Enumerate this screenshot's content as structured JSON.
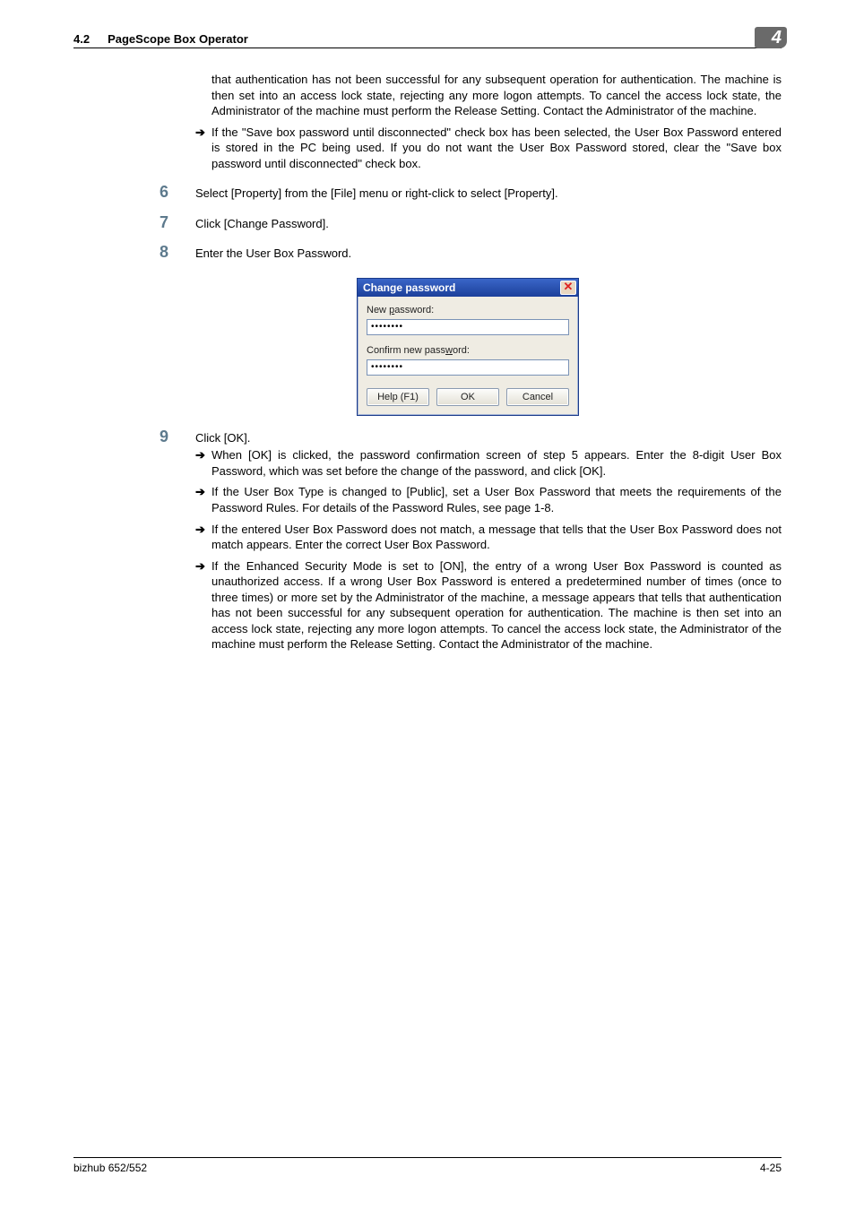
{
  "header": {
    "section_number": "4.2",
    "section_title": "PageScope Box Operator",
    "chapter_badge": "4"
  },
  "top_paragraph": "that authentication has not been successful for any subsequent operation for authentication. The machine is then set into an access lock state, rejecting any more logon attempts. To cancel the access lock state, the Administrator of the machine must perform the Release Setting. Contact the Administrator of the machine.",
  "top_bullet": "If the \"Save box password until disconnected\" check box has been selected, the User Box Password entered is stored in the PC being used. If you do not want the User Box Password stored, clear the \"Save box password until disconnected\" check box.",
  "step6": {
    "num": "6",
    "text": "Select [Property] from the [File] menu or right-click to select [Property]."
  },
  "step7": {
    "num": "7",
    "text": "Click [Change Password]."
  },
  "step8": {
    "num": "8",
    "text": "Enter the User Box Password."
  },
  "dialog": {
    "title": "Change password",
    "label_new_pre": "New ",
    "label_new_u": "p",
    "label_new_post": "assword:",
    "label_confirm_pre": "Confirm new pass",
    "label_confirm_u": "w",
    "label_confirm_post": "ord:",
    "value_new": "••••••••",
    "value_confirm": "••••••••",
    "btn_help": "Help (F1)",
    "btn_ok": "OK",
    "btn_cancel": "Cancel"
  },
  "step9": {
    "num": "9",
    "text": "Click [OK]."
  },
  "step9_bullets": [
    "When [OK] is clicked, the password confirmation screen of step 5 appears. Enter the 8-digit User Box Password, which was set before the change of the password, and click [OK].",
    "If the User Box Type is changed to [Public], set a User Box Password that meets the requirements of the Password Rules. For details of the Password Rules, see page 1-8.",
    "If the entered User Box Password does not match, a message that tells that the User Box Password does not match appears. Enter the correct User Box Password.",
    "If the Enhanced Security Mode is set to [ON], the entry of a wrong User Box Password is counted as unauthorized access. If a wrong User Box Password is entered a predetermined number of times (once to three times) or more set by the Administrator of the machine, a message appears that tells that authentication has not been successful for any subsequent operation for authentication. The machine is then set into an access lock state, rejecting any more logon attempts. To cancel the access lock state, the Administrator of the machine must perform the Release Setting. Contact the Administrator of the machine."
  ],
  "footer": {
    "left": "bizhub 652/552",
    "right": "4-25"
  },
  "glyphs": {
    "arrow": "➔",
    "close": "✕"
  }
}
